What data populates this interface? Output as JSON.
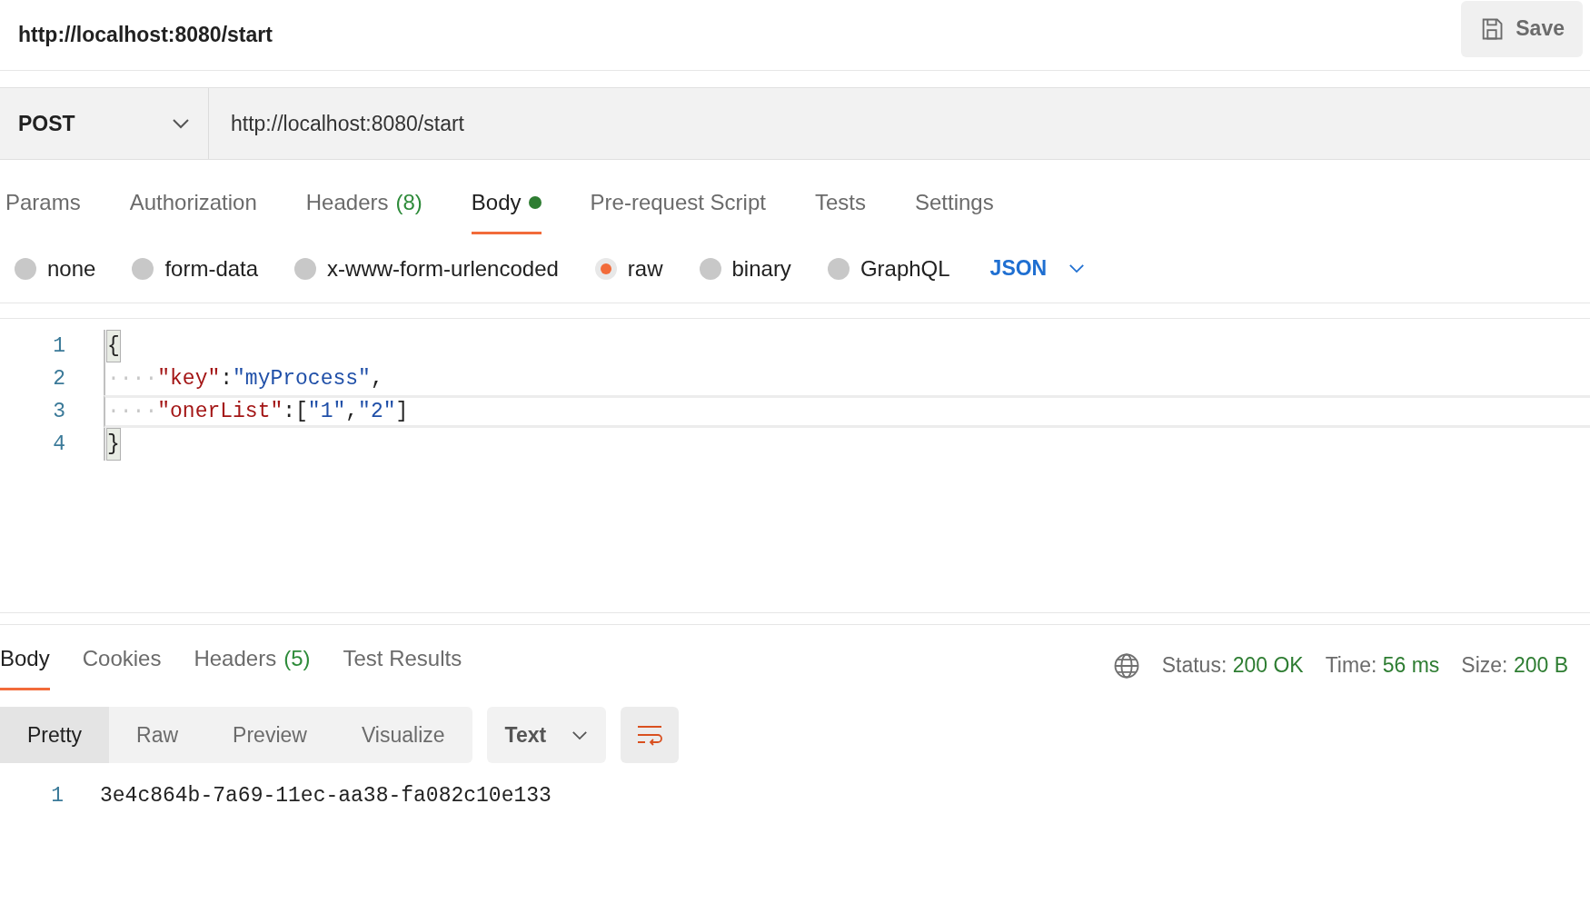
{
  "header": {
    "title": "http://localhost:8080/start",
    "save_button": "Save"
  },
  "request": {
    "method": "POST",
    "url": "http://localhost:8080/start",
    "tabs": [
      {
        "label": "Params",
        "selected": false
      },
      {
        "label": "Authorization",
        "selected": false
      },
      {
        "label": "Headers",
        "count": "(8)",
        "selected": false
      },
      {
        "label": "Body",
        "selected": true,
        "dot": true
      },
      {
        "label": "Pre-request Script",
        "selected": false
      },
      {
        "label": "Tests",
        "selected": false
      },
      {
        "label": "Settings",
        "selected": false
      }
    ],
    "body_types": [
      {
        "label": "none",
        "selected": false
      },
      {
        "label": "form-data",
        "selected": false
      },
      {
        "label": "x-www-form-urlencoded",
        "selected": false
      },
      {
        "label": "raw",
        "selected": true
      },
      {
        "label": "binary",
        "selected": false
      },
      {
        "label": "GraphQL",
        "selected": false
      }
    ],
    "language": "JSON",
    "editor_lines": [
      {
        "number": "1",
        "active": false,
        "tokens": [
          {
            "kind": "bracket-match",
            "text": "{"
          }
        ]
      },
      {
        "number": "2",
        "active": false,
        "tokens": [
          {
            "kind": "whitespace",
            "text": "····"
          },
          {
            "kind": "key",
            "text": "\"key\""
          },
          {
            "kind": "punct",
            "text": ":"
          },
          {
            "kind": "string",
            "text": "\"myProcess\""
          },
          {
            "kind": "punct",
            "text": ","
          }
        ]
      },
      {
        "number": "3",
        "active": true,
        "tokens": [
          {
            "kind": "whitespace",
            "text": "····"
          },
          {
            "kind": "key",
            "text": "\"onerList\""
          },
          {
            "kind": "punct",
            "text": ":["
          },
          {
            "kind": "string",
            "text": "\"1\""
          },
          {
            "kind": "punct",
            "text": ","
          },
          {
            "kind": "string",
            "text": "\"2\""
          },
          {
            "kind": "punct",
            "text": "]"
          }
        ]
      },
      {
        "number": "4",
        "active": false,
        "tokens": [
          {
            "kind": "bracket-match",
            "text": "}"
          }
        ]
      }
    ]
  },
  "response": {
    "tabs": [
      {
        "label": "Body",
        "selected": true
      },
      {
        "label": "Cookies",
        "selected": false
      },
      {
        "label": "Headers",
        "count": "(5)",
        "selected": false
      },
      {
        "label": "Test Results",
        "selected": false
      }
    ],
    "stats": [
      {
        "label": "Status:",
        "value": "200 OK"
      },
      {
        "label": "Time:",
        "value": "56 ms"
      },
      {
        "label": "Size:",
        "value": "200 B"
      }
    ],
    "views": [
      {
        "label": "Pretty",
        "selected": true
      },
      {
        "label": "Raw",
        "selected": false
      },
      {
        "label": "Preview",
        "selected": false
      },
      {
        "label": "Visualize",
        "selected": false
      }
    ],
    "format": "Text",
    "lines": [
      {
        "number": "1",
        "text": "3e4c864b-7a69-11ec-aa38-fa082c10e133"
      }
    ]
  }
}
